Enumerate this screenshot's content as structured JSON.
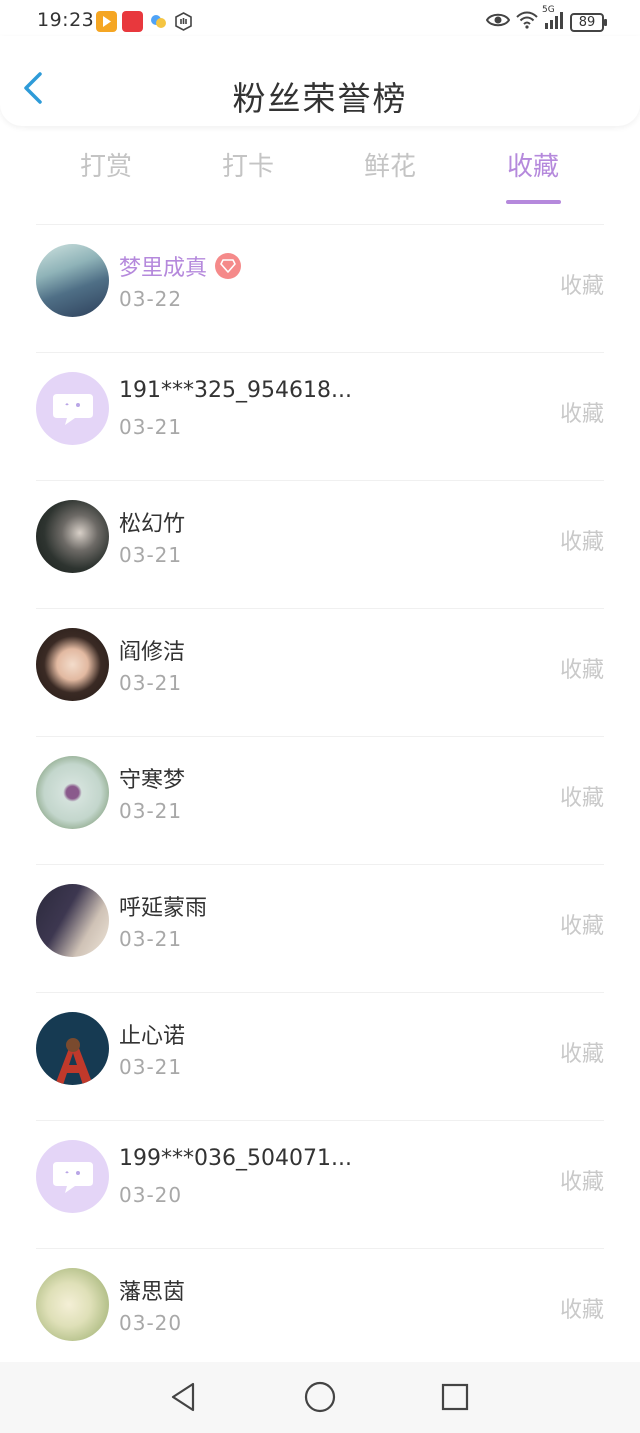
{
  "status_bar": {
    "time": "19:23",
    "network": "5G",
    "battery": "89"
  },
  "header": {
    "title": "粉丝荣誉榜"
  },
  "tabs": [
    {
      "label": "打赏",
      "active": false
    },
    {
      "label": "打卡",
      "active": false
    },
    {
      "label": "鲜花",
      "active": false
    },
    {
      "label": "收藏",
      "active": true
    }
  ],
  "colors": {
    "accent": "#b589dc",
    "tab_inactive": "#c4c4c4",
    "date": "#a8a8a8",
    "action": "#c9c9c9",
    "badge": "#f58a8a"
  },
  "list": [
    {
      "name": "梦里成真",
      "date": "03-22",
      "action": "收藏",
      "highlight": true,
      "avatar": "photo"
    },
    {
      "name": "191***325_954618...",
      "date": "03-21",
      "action": "收藏",
      "highlight": false,
      "avatar": "default-chat-avatar"
    },
    {
      "name": "松幻竹",
      "date": "03-21",
      "action": "收藏",
      "highlight": false,
      "avatar": "photo"
    },
    {
      "name": "阎修洁",
      "date": "03-21",
      "action": "收藏",
      "highlight": false,
      "avatar": "photo"
    },
    {
      "name": "守寒梦",
      "date": "03-21",
      "action": "收藏",
      "highlight": false,
      "avatar": "photo"
    },
    {
      "name": "呼延蒙雨",
      "date": "03-21",
      "action": "收藏",
      "highlight": false,
      "avatar": "photo"
    },
    {
      "name": "止心诺",
      "date": "03-21",
      "action": "收藏",
      "highlight": false,
      "avatar": "photo"
    },
    {
      "name": "199***036_504071...",
      "date": "03-20",
      "action": "收藏",
      "highlight": false,
      "avatar": "default-chat-avatar"
    },
    {
      "name": "藩思茵",
      "date": "03-20",
      "action": "收藏",
      "highlight": false,
      "avatar": "photo"
    }
  ],
  "nav": {
    "icons": [
      "back-triangle-icon",
      "home-circle-icon",
      "recents-square-icon"
    ]
  }
}
